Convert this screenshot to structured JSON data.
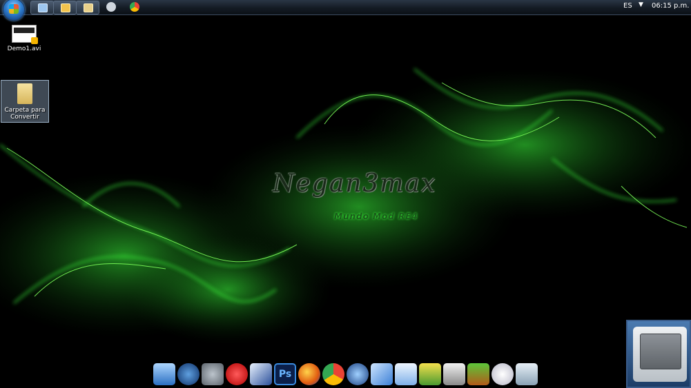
{
  "taskbar": {
    "start_label": "Start",
    "lang": "ES",
    "time": "06:15 p.m."
  },
  "desktop_icons": [
    {
      "label": "Demo1.avi"
    },
    {
      "label": "Carpeta para Convertir"
    }
  ],
  "wallpaper": {
    "logo_text": "Negan3max",
    "subtitle": "Mundo Mod RE4",
    "accent": "#3cff3c"
  },
  "dock_icons": [
    "computer-icon",
    "settings-gear-icon",
    "steam-icon",
    "record-icon",
    "paint-icon",
    "photoshop-icon",
    "firefox-icon",
    "chrome-icon",
    "media-player-icon",
    "check-icon",
    "t3-icon",
    "music-icon",
    "display-icon",
    "tree-icon",
    "disc-icon",
    "recycle-bin-icon"
  ]
}
